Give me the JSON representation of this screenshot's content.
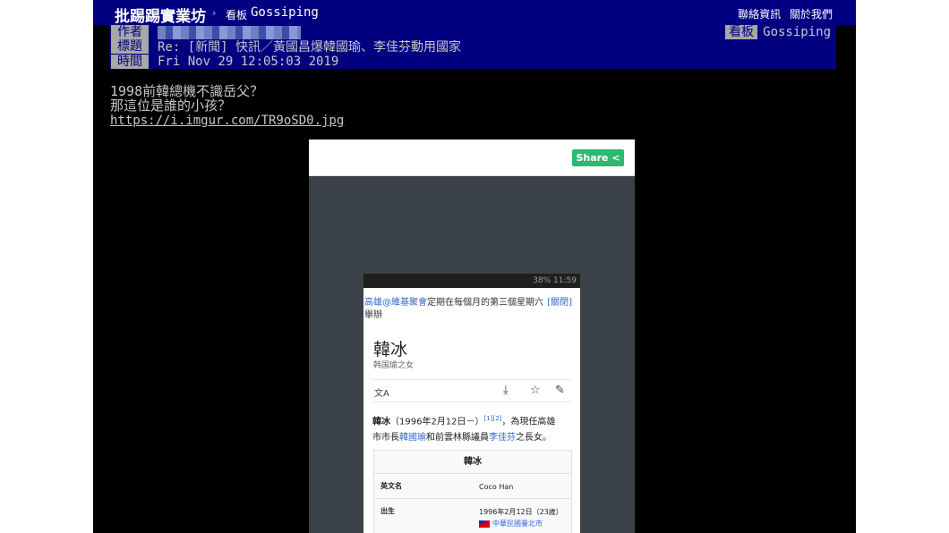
{
  "topbar": {
    "site_name": "批踢踢實業坊",
    "crumb_sep": "›",
    "crumb_label": "看板",
    "board": "Gossiping",
    "links": [
      "聯絡資訊",
      "關於我們"
    ]
  },
  "header": {
    "author_label": "作者",
    "title_label": "標題",
    "time_label": "時間",
    "board_label": "看板",
    "board_value": "Gossiping",
    "title_value": "Re: [新聞] 快訊／黃國昌爆韓國瑜、李佳芬動用國家",
    "time_value": "Fri Nov 29 12:05:03 2019"
  },
  "body": {
    "lines": [
      "1998前韓總機不識岳父？",
      "那這位是誰的小孩？"
    ],
    "link": "https://i.imgur.com/TR9oSD0.jpg"
  },
  "embed": {
    "share_label": "Share <",
    "phone": {
      "status": "38% 11:59",
      "banner_link": "高雄@維基聚會",
      "banner_text": "定期在每個月的第三個星期六",
      "banner_close": "[關閉]",
      "banner_text2": "舉辦",
      "title": "韓冰",
      "subtitle": "韩国瑜之女",
      "tool_translate": "文A",
      "tool_download": "⤓",
      "tool_star": "☆",
      "tool_edit": "✎",
      "intro_name": "韓冰",
      "intro_date": "（1996年2月12日－）",
      "intro_ref": "[1][2]",
      "intro_text1": "，為現任高雄",
      "intro_text2": "市市長",
      "intro_link1": "韓國瑜",
      "intro_text3": "和前雲林縣議員",
      "intro_link2": "李佳芬",
      "intro_text4": "之長女。",
      "infobox": {
        "title": "韓冰",
        "rows": [
          {
            "key": "英文名",
            "value": "Coco Han"
          },
          {
            "key": "出生",
            "value": "1996年2月12日（23歲）",
            "value2": "中華民國臺北市"
          }
        ]
      }
    }
  },
  "colors": {
    "bar": "#000080",
    "label_bg": "#a8a8a8",
    "text": "#c8c8c8",
    "share": "#2eb872"
  }
}
